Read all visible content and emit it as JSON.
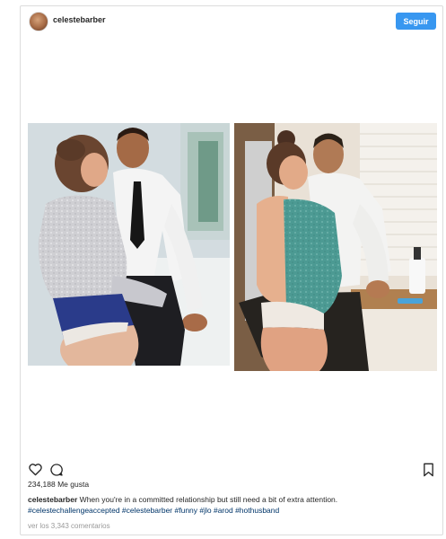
{
  "post": {
    "username": "celestebarber",
    "follow_label": "Seguir",
    "likes_text": "234,188 Me gusta",
    "caption": {
      "username": "celestebarber",
      "text": "When you're in a committed relationship but still need a bit of extra attention.",
      "hashtags": "#celestechallengeaccepted #celestebarber #funny #jlo #arod #hothusband"
    },
    "comments_link": "ver los 3,343 comentarios"
  },
  "icons": {
    "like": "heart-icon",
    "comment": "comment-icon",
    "save": "bookmark-icon"
  },
  "colors": {
    "follow_button": "#3897f0",
    "hashtag": "#003569",
    "muted_text": "#999999"
  }
}
